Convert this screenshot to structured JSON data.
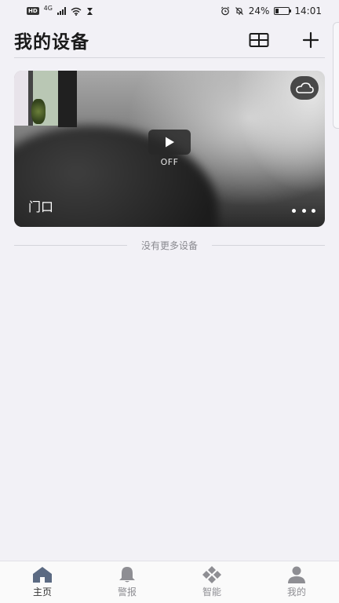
{
  "status_bar": {
    "network_type": "4G",
    "battery_percent": "24%",
    "battery_level": 0.24,
    "time": "14:01",
    "icons": [
      "hd-icon",
      "signal-icon",
      "wifi-icon",
      "hourglass-icon",
      "alarm-icon",
      "mute-bell-icon",
      "battery-icon"
    ]
  },
  "header": {
    "title": "我的设备",
    "actions": [
      "grid-view-icon",
      "add-icon"
    ]
  },
  "devices": [
    {
      "name": "门口",
      "play_state": "OFF",
      "icons": [
        "play-icon",
        "cloud-icon",
        "more-icon"
      ]
    }
  ],
  "list_footer": "没有更多设备",
  "bottom_nav": {
    "active": "home",
    "items": [
      {
        "label": "主页",
        "icon": "home-icon"
      },
      {
        "label": "警报",
        "icon": "bell-icon"
      },
      {
        "label": "智能",
        "icon": "smart-icon"
      },
      {
        "label": "我的",
        "icon": "profile-icon"
      }
    ]
  },
  "colors": {
    "background": "#f2f1f6",
    "active_tab": "#5b6a82",
    "inactive_tab": "#8e8e93"
  }
}
